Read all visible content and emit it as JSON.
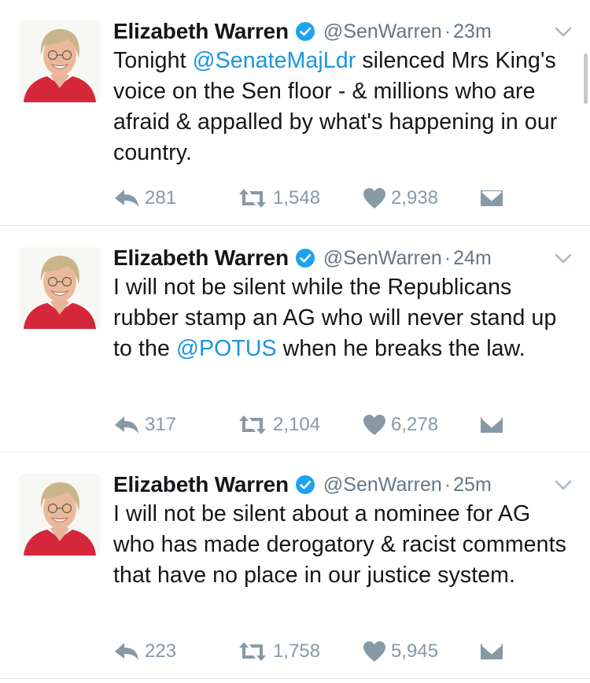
{
  "colors": {
    "text": "#14171a",
    "secondary": "#657786",
    "action_gray": "#8899a6",
    "mention_blue": "#1b95e0",
    "verified_blue": "#1da1f2",
    "divider": "#e1e8ed"
  },
  "icons": {
    "verified": "verified-badge-icon",
    "caret": "chevron-down-icon",
    "reply": "reply-icon",
    "retweet": "retweet-icon",
    "like": "heart-icon",
    "dm": "direct-message-icon"
  },
  "tweets": [
    {
      "name": "Elizabeth Warren",
      "handle": "@SenWarren",
      "separator": "·",
      "time": "23m",
      "text": [
        {
          "t": "Tonight ",
          "mention": false
        },
        {
          "t": "@SenateMajLdr",
          "mention": true
        },
        {
          "t": " silenced Mrs King's voice on the Sen floor - & millions who are afraid & appalled by what's happening in our country.",
          "mention": false
        }
      ],
      "replies": "281",
      "retweets": "1,548",
      "likes": "2,938"
    },
    {
      "name": "Elizabeth Warren",
      "handle": "@SenWarren",
      "separator": "·",
      "time": "24m",
      "text": [
        {
          "t": "I will not be silent while the Republicans rubber stamp an AG who will never stand up to the ",
          "mention": false
        },
        {
          "t": "@POTUS",
          "mention": true
        },
        {
          "t": " when he breaks the law.",
          "mention": false
        }
      ],
      "replies": "317",
      "retweets": "2,104",
      "likes": "6,278"
    },
    {
      "name": "Elizabeth Warren",
      "handle": "@SenWarren",
      "separator": "·",
      "time": "25m",
      "text": [
        {
          "t": "I will not be silent about a nominee for AG who has made derogatory & racist comments that have no place in our justice system.",
          "mention": false
        }
      ],
      "replies": "223",
      "retweets": "1,758",
      "likes": "5,945"
    }
  ]
}
